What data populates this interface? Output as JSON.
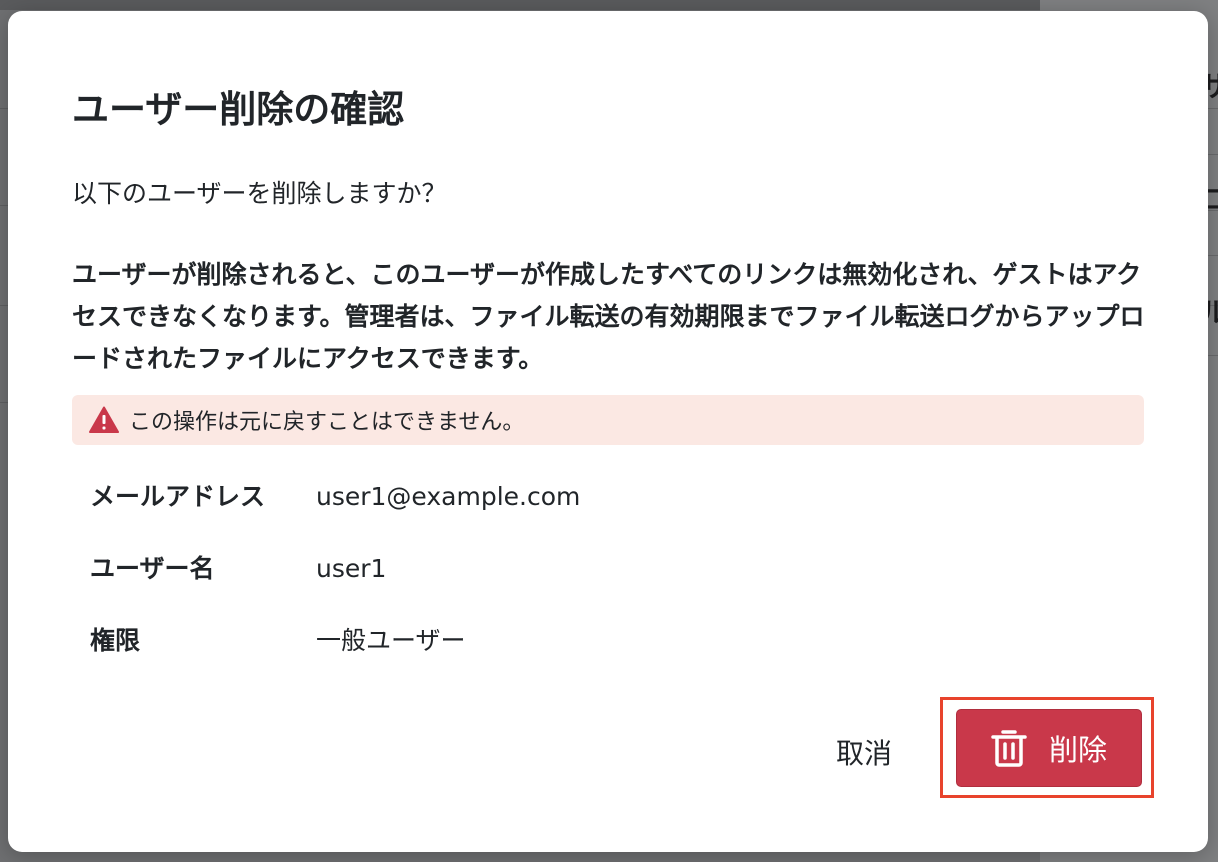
{
  "background": {
    "peek_chars": [
      "サ",
      "ロ",
      "ル"
    ]
  },
  "dialog": {
    "title": "ユーザー削除の確認",
    "question": "以下のユーザーを削除しますか？",
    "warning": "ユーザーが削除されると、このユーザーが作成したすべてのリンクは無効化され、ゲストはアクセスできなくなります。管理者は、ファイル転送の有効期限までファイル転送ログからアップロードされたファイルにアクセスできます。",
    "alert": {
      "icon": "warning-triangle-icon",
      "text": "この操作は元に戻すことはできません。",
      "color": "#c9384a",
      "background": "#fbe8e3"
    },
    "details": [
      {
        "label": "メールアドレス",
        "value": "user1@example.com"
      },
      {
        "label": "ユーザー名",
        "value": "user1"
      },
      {
        "label": "権限",
        "value": "一般ユーザー"
      }
    ],
    "buttons": {
      "cancel_label": "取消",
      "delete_label": "削除",
      "delete_icon": "trash-icon",
      "delete_color": "#c9384a",
      "highlight_color": "#e8432c"
    }
  }
}
